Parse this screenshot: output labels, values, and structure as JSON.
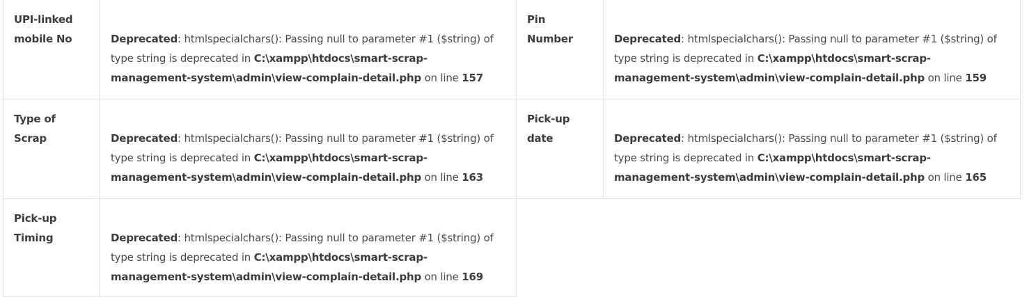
{
  "rows": [
    {
      "cells": [
        {
          "label": "UPI-linked mobile No",
          "error": {
            "prefix": "Deprecated",
            "message": ": htmlspecialchars(): Passing null to parameter #1 ($string) of type string is deprecated in ",
            "file": "C:\\xampp\\htdocs\\smart-scrap-management-system\\admin\\view-complain-detail.php",
            "on_line": " on line ",
            "line": "157"
          }
        },
        {
          "label": "Pin Number",
          "error": {
            "prefix": "Deprecated",
            "message": ": htmlspecialchars(): Passing null to parameter #1 ($string) of type string is deprecated in ",
            "file": "C:\\xampp\\htdocs\\smart-scrap-management-system\\admin\\view-complain-detail.php",
            "on_line": " on line ",
            "line": "159"
          }
        }
      ]
    },
    {
      "cells": [
        {
          "label": "Type of Scrap",
          "error": {
            "prefix": "Deprecated",
            "message": ": htmlspecialchars(): Passing null to parameter #1 ($string) of type string is deprecated in ",
            "file": "C:\\xampp\\htdocs\\smart-scrap-management-system\\admin\\view-complain-detail.php",
            "on_line": " on line ",
            "line": "163"
          }
        },
        {
          "label": "Pick-up date",
          "error": {
            "prefix": "Deprecated",
            "message": ": htmlspecialchars(): Passing null to parameter #1 ($string) of type string is deprecated in ",
            "file": "C:\\xampp\\htdocs\\smart-scrap-management-system\\admin\\view-complain-detail.php",
            "on_line": " on line ",
            "line": "165"
          }
        }
      ]
    },
    {
      "cells": [
        {
          "label": "Pick-up Timing",
          "error": {
            "prefix": "Deprecated",
            "message": ": htmlspecialchars(): Passing null to parameter #1 ($string) of type string is deprecated in ",
            "file": "C:\\xampp\\htdocs\\smart-scrap-management-system\\admin\\view-complain-detail.php",
            "on_line": " on line ",
            "line": "169"
          }
        }
      ]
    }
  ]
}
